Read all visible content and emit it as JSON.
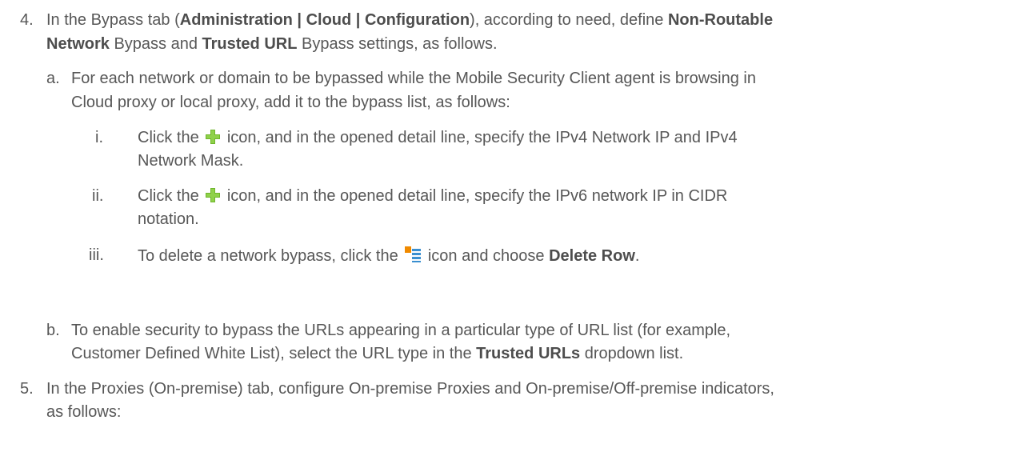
{
  "step4": {
    "number": "4.",
    "l1_a": "In the Bypass tab (",
    "l1_b": "Administration | Cloud | Configuration",
    "l1_c": "), according to need, define ",
    "l1_d": "Non-Routable",
    "l2_a": "Network",
    "l2_b": " Bypass and ",
    "l2_c": "Trusted URL",
    "l2_d": " Bypass settings, as follows."
  },
  "step4a": {
    "number": "a.",
    "l1": "For each network or domain to be bypassed while the Mobile Security Client agent is browsing in",
    "l2": "Cloud proxy or local proxy, add it to the bypass list, as follows:"
  },
  "step4ai": {
    "number": "i.",
    "l1_a": "Click the",
    "l1_b": "icon, and in the opened detail line, specify the IPv4 Network IP and IPv4",
    "l2": "Network Mask."
  },
  "step4aii": {
    "number": "ii.",
    "l1_a": "Click the",
    "l1_b": "icon, and in the opened detail line, specify the IPv6 network IP in CIDR",
    "l2": "notation."
  },
  "step4aiii": {
    "number": "iii.",
    "l1_a": "To delete a network bypass, click the",
    "l1_b": "icon and choose ",
    "l1_c": "Delete Row",
    "l1_d": "."
  },
  "step4b": {
    "number": "b.",
    "l1": "To enable security to bypass the URLs appearing in a particular type of URL list (for example,",
    "l2_a": "Customer Defined White List), select the URL type in the ",
    "l2_b": "Trusted URLs",
    "l2_c": " dropdown list."
  },
  "step5": {
    "number": "5.",
    "l1": "In the Proxies (On-premise) tab, configure On-premise Proxies and On-premise/Off-premise indicators,",
    "l2": "as follows:"
  },
  "icons": [
    "plus-icon",
    "plus-icon",
    "row-menu-icon"
  ],
  "colors": {
    "text": "#575757",
    "plus_green": "#6fb52c",
    "menu_orange": "#f08a00",
    "menu_blue": "#3a8fd0"
  }
}
